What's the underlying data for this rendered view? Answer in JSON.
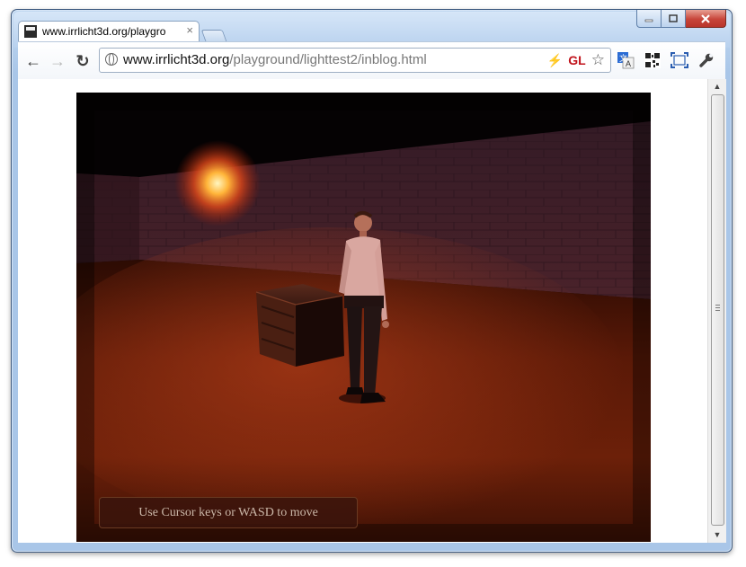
{
  "browser": {
    "tab_title": "www.irrlicht3d.org/playgro",
    "tab_close_glyph": "×",
    "url_domain": "www.irrlicht3d.org",
    "url_path": "/playground/lighttest2/inblog.html",
    "omnibox_badge": "GL",
    "back_glyph": "←",
    "forward_glyph": "→",
    "reload_glyph": "↻",
    "bolt_glyph": "⚡",
    "star_glyph": "☆"
  },
  "icons": {
    "tab_favicon": "irrlicht-favicon",
    "back": "back-arrow-icon",
    "forward": "forward-arrow-icon",
    "reload": "reload-icon",
    "page": "globe-icon",
    "extensions": [
      "translate-icon",
      "qr-code-icon",
      "fullscreen-icon",
      "wrench-icon"
    ]
  },
  "game": {
    "hint": "Use Cursor keys or WASD to move"
  },
  "colors": {
    "frame": "#a9c6e8",
    "close_button": "#c7453a",
    "gl_badge": "#c0121a",
    "hint_bg": "#3a140c",
    "hint_text": "#cbb7a8"
  }
}
